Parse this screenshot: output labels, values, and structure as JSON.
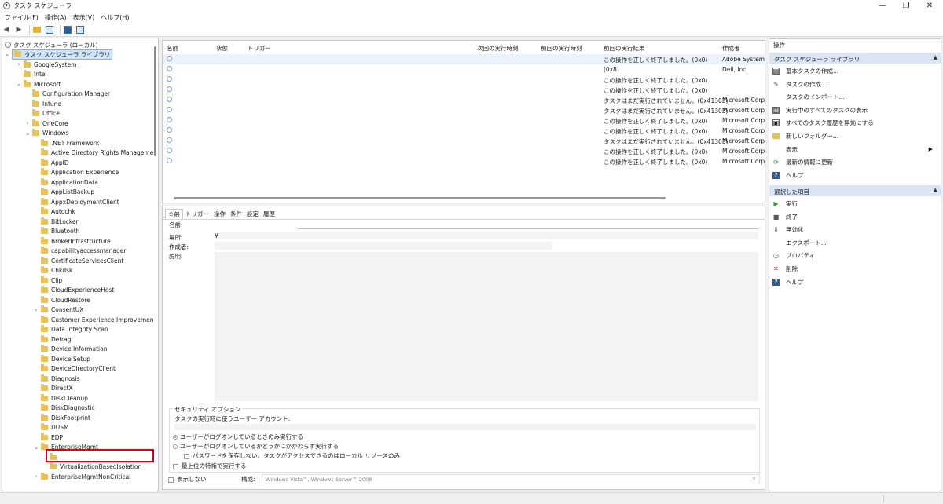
{
  "window": {
    "title": "タスク スケジューラ",
    "minimize": "—",
    "maximize": "❐",
    "close": "✕"
  },
  "menu": [
    "ファイル(F)",
    "操作(A)",
    "表示(V)",
    "ヘルプ(H)"
  ],
  "tree": {
    "root": "タスク スケジューラ (ローカル)",
    "library": "タスク スケジューラ ライブラリ",
    "items": [
      {
        "label": "GoogleSystem",
        "expander": "›"
      },
      {
        "label": "Intel",
        "expander": ""
      },
      {
        "label": "Microsoft",
        "expander": "⌄"
      },
      {
        "label": "Configuration Manager",
        "expander": ""
      },
      {
        "label": "Intune",
        "expander": ""
      },
      {
        "label": "Office",
        "expander": ""
      },
      {
        "label": "OneCore",
        "expander": "›"
      },
      {
        "label": "Windows",
        "expander": "⌄"
      },
      {
        "label": ".NET Framework",
        "expander": ""
      },
      {
        "label": "Active Directory Rights Manageme",
        "expander": ""
      },
      {
        "label": "AppID",
        "expander": ""
      },
      {
        "label": "Application Experience",
        "expander": ""
      },
      {
        "label": "ApplicationData",
        "expander": ""
      },
      {
        "label": "AppListBackup",
        "expander": ""
      },
      {
        "label": "AppxDeploymentClient",
        "expander": ""
      },
      {
        "label": "Autochk",
        "expander": ""
      },
      {
        "label": "BitLocker",
        "expander": ""
      },
      {
        "label": "Bluetooth",
        "expander": ""
      },
      {
        "label": "BrokerInfrastructure",
        "expander": ""
      },
      {
        "label": "capabilityaccessmanager",
        "expander": ""
      },
      {
        "label": "CertificateServicesClient",
        "expander": ""
      },
      {
        "label": "Chkdsk",
        "expander": ""
      },
      {
        "label": "Clip",
        "expander": ""
      },
      {
        "label": "CloudExperienceHost",
        "expander": ""
      },
      {
        "label": "CloudRestore",
        "expander": ""
      },
      {
        "label": "ConsentUX",
        "expander": "›"
      },
      {
        "label": "Customer Experience Improvemen",
        "expander": ""
      },
      {
        "label": "Data Integrity Scan",
        "expander": ""
      },
      {
        "label": "Defrag",
        "expander": ""
      },
      {
        "label": "Device Information",
        "expander": ""
      },
      {
        "label": "Device Setup",
        "expander": ""
      },
      {
        "label": "DeviceDirectoryClient",
        "expander": ""
      },
      {
        "label": "Diagnosis",
        "expander": ""
      },
      {
        "label": "DirectX",
        "expander": ""
      },
      {
        "label": "DiskCleanup",
        "expander": ""
      },
      {
        "label": "DiskDiagnostic",
        "expander": ""
      },
      {
        "label": "DiskFootprint",
        "expander": ""
      },
      {
        "label": "DUSM",
        "expander": ""
      },
      {
        "label": "EDP",
        "expander": ""
      },
      {
        "label": "EnterpriseMgmt",
        "expander": "⌄"
      },
      {
        "label": "",
        "expander": ""
      },
      {
        "label": "VirtualizationBasedIsolation",
        "expander": ""
      },
      {
        "label": "EnterpriseMgmtNonCritical",
        "expander": "›"
      }
    ]
  },
  "tasklist": {
    "columns": [
      "名前",
      "状態",
      "トリガー",
      "次回の実行時刻",
      "前回の実行時刻",
      "前回の実行結果",
      "作成者"
    ],
    "rows": [
      {
        "result": "この操作を正しく終了しました。(0x0)",
        "author": "Adobe Systems"
      },
      {
        "result": "(0x8)",
        "author": "Dell, Inc."
      },
      {
        "result": "この操作を正しく終了しました。(0x0)",
        "author": ""
      },
      {
        "result": "この操作を正しく終了しました。(0x0)",
        "author": ""
      },
      {
        "result": "タスクはまだ実行されていません。(0x41303)",
        "author": "Microsoft Corp"
      },
      {
        "result": "タスクはまだ実行されていません。(0x41303)",
        "author": "Microsoft Corp"
      },
      {
        "result": "この操作を正しく終了しました。(0x0)",
        "author": "Microsoft Corp"
      },
      {
        "result": "この操作を正しく終了しました。(0x0)",
        "author": "Microsoft Corp"
      },
      {
        "result": "タスクはまだ実行されていません。(0x41303)",
        "author": "Microsoft Corp"
      },
      {
        "result": "この操作を正しく終了しました。(0x0)",
        "author": "Microsoft Corp"
      },
      {
        "result": "この操作を正しく終了しました。(0x0)",
        "author": "Microsoft Corp"
      }
    ]
  },
  "details": {
    "tabs": [
      "全般",
      "トリガー",
      "操作",
      "条件",
      "設定",
      "履歴"
    ],
    "name_label": "名前:",
    "location_label": "場所:",
    "location_value": "¥",
    "author_label": "作成者:",
    "description_label": "説明:",
    "security_title": "セキュリティ オプション",
    "run_as_label": "タスクの実行時に使うユーザー アカウント:",
    "radio_logged_on": "ユーザーがログオンしているときのみ実行する",
    "radio_whether": "ユーザーがログオンしているかどうかにかかわらず実行する",
    "no_password": "パスワードを保存しない。タスクがアクセスできるのはローカル リソースのみ",
    "highest_priv": "最上位の特権で実行する",
    "hidden": "表示しない",
    "config_label": "構成:",
    "config_value": "Windows Vista™, Windows Server™ 2008"
  },
  "actions": {
    "header": "操作",
    "section1": "タスク スケジューラ ライブラリ",
    "items1": [
      {
        "label": "基本タスクの作成...",
        "icon": "basic-task-icon"
      },
      {
        "label": "タスクの作成...",
        "icon": "create-task-icon"
      },
      {
        "label": "タスクのインポート...",
        "icon": ""
      },
      {
        "label": "実行中のすべてのタスクの表示",
        "icon": "running-tasks-icon"
      },
      {
        "label": "すべてのタスク履歴を無効にする",
        "icon": "history-icon"
      },
      {
        "label": "新しいフォルダー...",
        "icon": "folder-icon"
      },
      {
        "label": "表示",
        "icon": ""
      },
      {
        "label": "最新の情報に更新",
        "icon": "refresh-icon"
      },
      {
        "label": "ヘルプ",
        "icon": "help-icon"
      }
    ],
    "section2": "選択した項目",
    "items2": [
      {
        "label": "実行",
        "icon": "run-icon"
      },
      {
        "label": "終了",
        "icon": "stop-icon"
      },
      {
        "label": "無効化",
        "icon": "disable-icon"
      },
      {
        "label": "エクスポート...",
        "icon": ""
      },
      {
        "label": "プロパティ",
        "icon": "properties-icon"
      },
      {
        "label": "削除",
        "icon": "delete-icon"
      },
      {
        "label": "ヘルプ",
        "icon": "help-icon"
      }
    ]
  }
}
